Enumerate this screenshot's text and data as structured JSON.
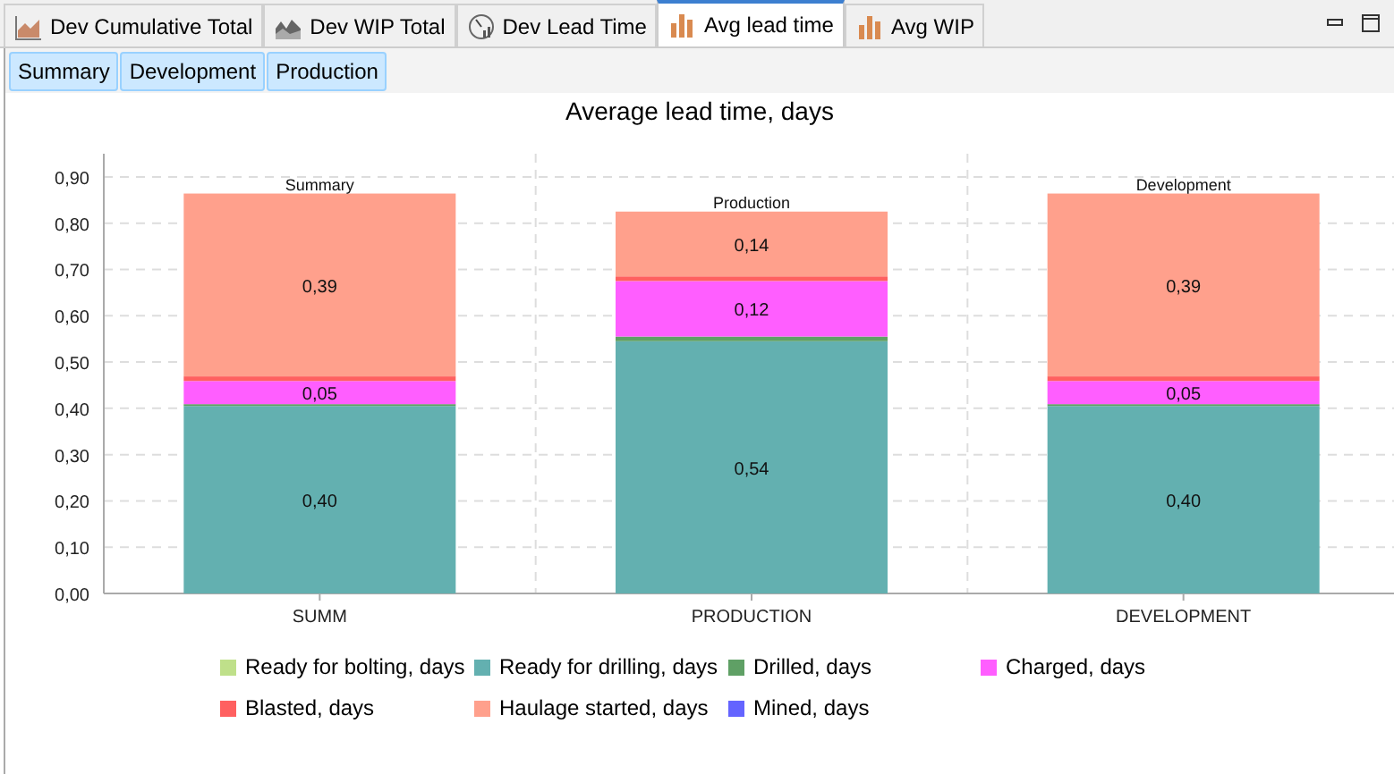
{
  "tabs": [
    {
      "label": "Dev Cumulative Total",
      "kind": "area",
      "selected": false
    },
    {
      "label": "Dev WIP Total",
      "kind": "mountain",
      "selected": false
    },
    {
      "label": "Dev Lead Time",
      "kind": "gauge",
      "selected": false
    },
    {
      "label": "Avg lead time",
      "kind": "bars",
      "selected": true
    },
    {
      "label": "Avg WIP",
      "kind": "bars",
      "selected": false
    }
  ],
  "sub_tabs": [
    {
      "label": "Summary",
      "selected": true
    },
    {
      "label": "Development",
      "selected": true
    },
    {
      "label": "Production",
      "selected": true
    }
  ],
  "chart": {
    "chart_data": {
      "type": "bar",
      "title": "Average lead time, days",
      "stacked": true,
      "grid": true,
      "categories": [
        "SUMM",
        "PRODUCTION",
        "DEVELOPMENT"
      ],
      "ylim": [
        0,
        0.95
      ],
      "yticks": [
        {
          "value": 0,
          "label": "0,00"
        },
        {
          "value": 0.1,
          "label": "0,10"
        },
        {
          "value": 0.2,
          "label": "0,20"
        },
        {
          "value": 0.3,
          "label": "0,30"
        },
        {
          "value": 0.4,
          "label": "0,40"
        },
        {
          "value": 0.5,
          "label": "0,50"
        },
        {
          "value": 0.6,
          "label": "0,60"
        },
        {
          "value": 0.7,
          "label": "0,70"
        },
        {
          "value": 0.8,
          "label": "0,80"
        },
        {
          "value": 0.9,
          "label": "0,90"
        }
      ],
      "series": [
        {
          "name": "Ready for bolting, days",
          "color": "#bfe08a",
          "values": [
            0,
            0,
            0
          ]
        },
        {
          "name": "Ready for drilling, days",
          "color": "#63b0b0",
          "values": [
            0.405,
            0.545,
            0.405
          ]
        },
        {
          "name": "Drilled, days",
          "color": "#5fa065",
          "values": [
            0.004,
            0.01,
            0.004
          ]
        },
        {
          "name": "Charged, days",
          "color": "#ff5eff",
          "values": [
            0.05,
            0.12,
            0.05
          ]
        },
        {
          "name": "Blasted, days",
          "color": "#ff6060",
          "values": [
            0.01,
            0.01,
            0.01
          ]
        },
        {
          "name": "Haulage started, days",
          "color": "#ffa08c",
          "values": [
            0.395,
            0.14,
            0.395
          ]
        },
        {
          "name": "Mined, days",
          "color": "#6464ff",
          "values": [
            0,
            0,
            0
          ]
        }
      ],
      "value_labels": [
        [
          null,
          "0,40",
          null,
          "0,05",
          null,
          "0,39",
          null
        ],
        [
          null,
          "0,54",
          null,
          "0,12",
          null,
          "0,14",
          null
        ],
        [
          null,
          "0,40",
          null,
          "0,05",
          null,
          "0,39",
          null
        ]
      ],
      "annotations": [
        "Summary",
        "Production",
        "Development"
      ]
    }
  }
}
